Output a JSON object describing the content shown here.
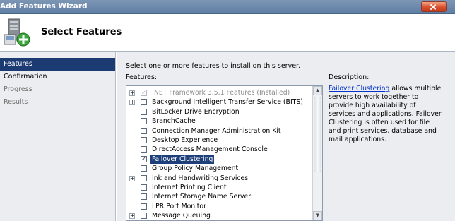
{
  "window": {
    "title": "Add Features Wizard"
  },
  "header": {
    "page_title": "Select Features",
    "icon": "server-add-icon"
  },
  "nav": {
    "items": [
      {
        "label": "Features",
        "state": "active"
      },
      {
        "label": "Confirmation",
        "state": "normal"
      },
      {
        "label": "Progress",
        "state": "disabled"
      },
      {
        "label": "Results",
        "state": "disabled"
      }
    ]
  },
  "main": {
    "instruction": "Select one or more features to install on this server.",
    "features_label": "Features:",
    "features": [
      {
        "label": ".NET Framework 3.5.1 Features  (Installed)",
        "expandable": true,
        "checked": true,
        "installed": true
      },
      {
        "label": "Background Intelligent Transfer Service (BITS)",
        "expandable": true,
        "checked": false
      },
      {
        "label": "BitLocker Drive Encryption",
        "expandable": false,
        "checked": false
      },
      {
        "label": "BranchCache",
        "expandable": false,
        "checked": false
      },
      {
        "label": "Connection Manager Administration Kit",
        "expandable": false,
        "checked": false
      },
      {
        "label": "Desktop Experience",
        "expandable": false,
        "checked": false
      },
      {
        "label": "DirectAccess Management Console",
        "expandable": false,
        "checked": false
      },
      {
        "label": "Failover Clustering",
        "expandable": false,
        "checked": true,
        "selected": true
      },
      {
        "label": "Group Policy Management",
        "expandable": false,
        "checked": false
      },
      {
        "label": "Ink and Handwriting Services",
        "expandable": true,
        "checked": false
      },
      {
        "label": "Internet Printing Client",
        "expandable": false,
        "checked": false
      },
      {
        "label": "Internet Storage Name Server",
        "expandable": false,
        "checked": false
      },
      {
        "label": "LPR Port Monitor",
        "expandable": false,
        "checked": false
      },
      {
        "label": "Message Queuing",
        "expandable": true,
        "checked": false
      }
    ],
    "description_title": "Description:",
    "description_link": "Failover Clustering",
    "description_text": " allows multiple servers to work together to provide high availability of services and applications. Failover Clustering is often used for file and print services, database and mail applications."
  },
  "colors": {
    "nav_active": "#1c3b73",
    "selection": "#1d3f7a",
    "link": "#0033cc",
    "titlebar": "#6f8bae"
  }
}
